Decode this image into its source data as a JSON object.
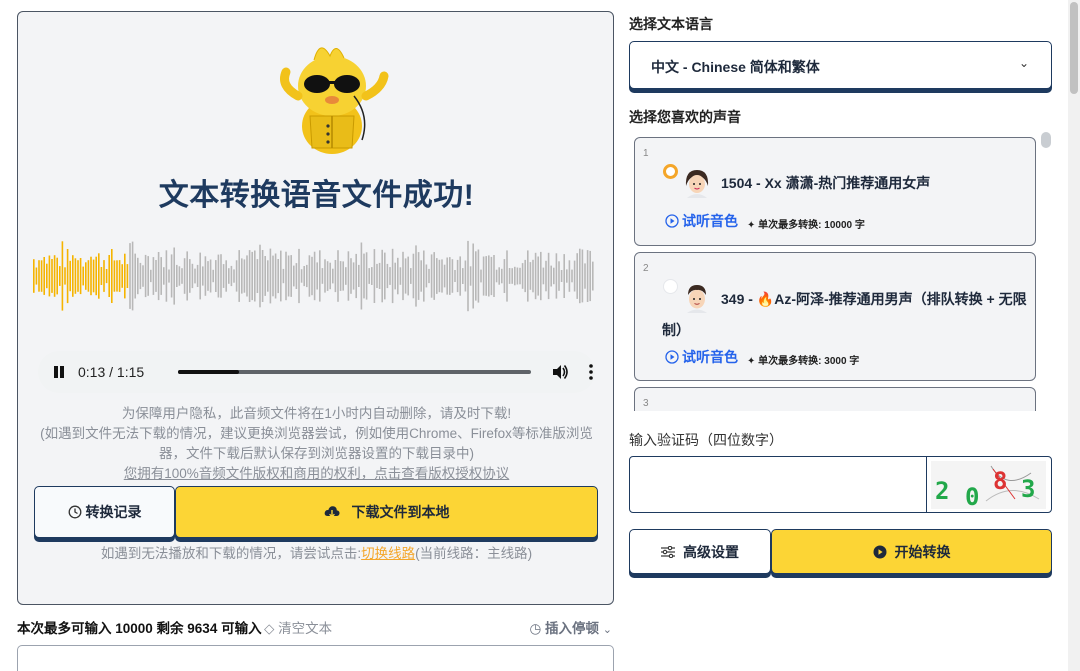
{
  "result": {
    "title": "文本转换语音文件成功!"
  },
  "player": {
    "time": "0:13 / 1:15",
    "progress": 0.173
  },
  "notice": {
    "line1": "为保障用户隐私，此音频文件将在1小时内自动删除，请及时下载!",
    "line2": "(如遇到文件无法下载的情况，建议更换浏览器尝试，例如使用Chrome、Firefox等标准版浏览器，文件下载后默认保存到浏览器设置的下载目录中)",
    "copyright_link": "您拥有100%音频文件版权和商用的权利，点击查看版权授权协议"
  },
  "actions": {
    "history_label": "转换记录",
    "download_label": "下载文件到本地"
  },
  "switch_line": {
    "prefix": "如遇到无法播放和下载的情况，请尝试点击:",
    "link": "切换线路",
    "suffix": "(当前线路：主线路)"
  },
  "editor": {
    "quota_text": "本次最多可输入 10000 剩余 9634 可输入",
    "clear_label": "清空文本",
    "insert_pause_label": "插入停顿"
  },
  "language": {
    "label": "选择文本语言",
    "selected": "中文 - Chinese 简体和繁体"
  },
  "voices": {
    "label": "选择您喜欢的声音",
    "items": [
      {
        "index": "1",
        "name": "1504 - Xx 潇潇-热门推荐通用女声",
        "listen_label": "试听音色",
        "limit": "单次最多转换: 10000 字",
        "selected": true
      },
      {
        "index": "2",
        "name_line1": "349 - 🔥Az-阿泽-推荐通用男声（排队转换 + 无限",
        "name_line2": "制）",
        "listen_label": "试听音色",
        "limit": "单次最多转换: 3000 字",
        "selected": false
      },
      {
        "index": "3"
      }
    ]
  },
  "captcha": {
    "label": "输入验证码（四位数字）",
    "value": "",
    "image_text": "2083"
  },
  "bottom_actions": {
    "advanced_label": "高级设置",
    "start_label": "开始转换"
  },
  "colors": {
    "accent_yellow": "#fcd535",
    "navy": "#1e3a5f",
    "waveform_played": "#f5b400",
    "waveform_unplayed": "#b8b8b8",
    "link_blue": "#2563eb",
    "link_orange": "#f4a62a"
  }
}
